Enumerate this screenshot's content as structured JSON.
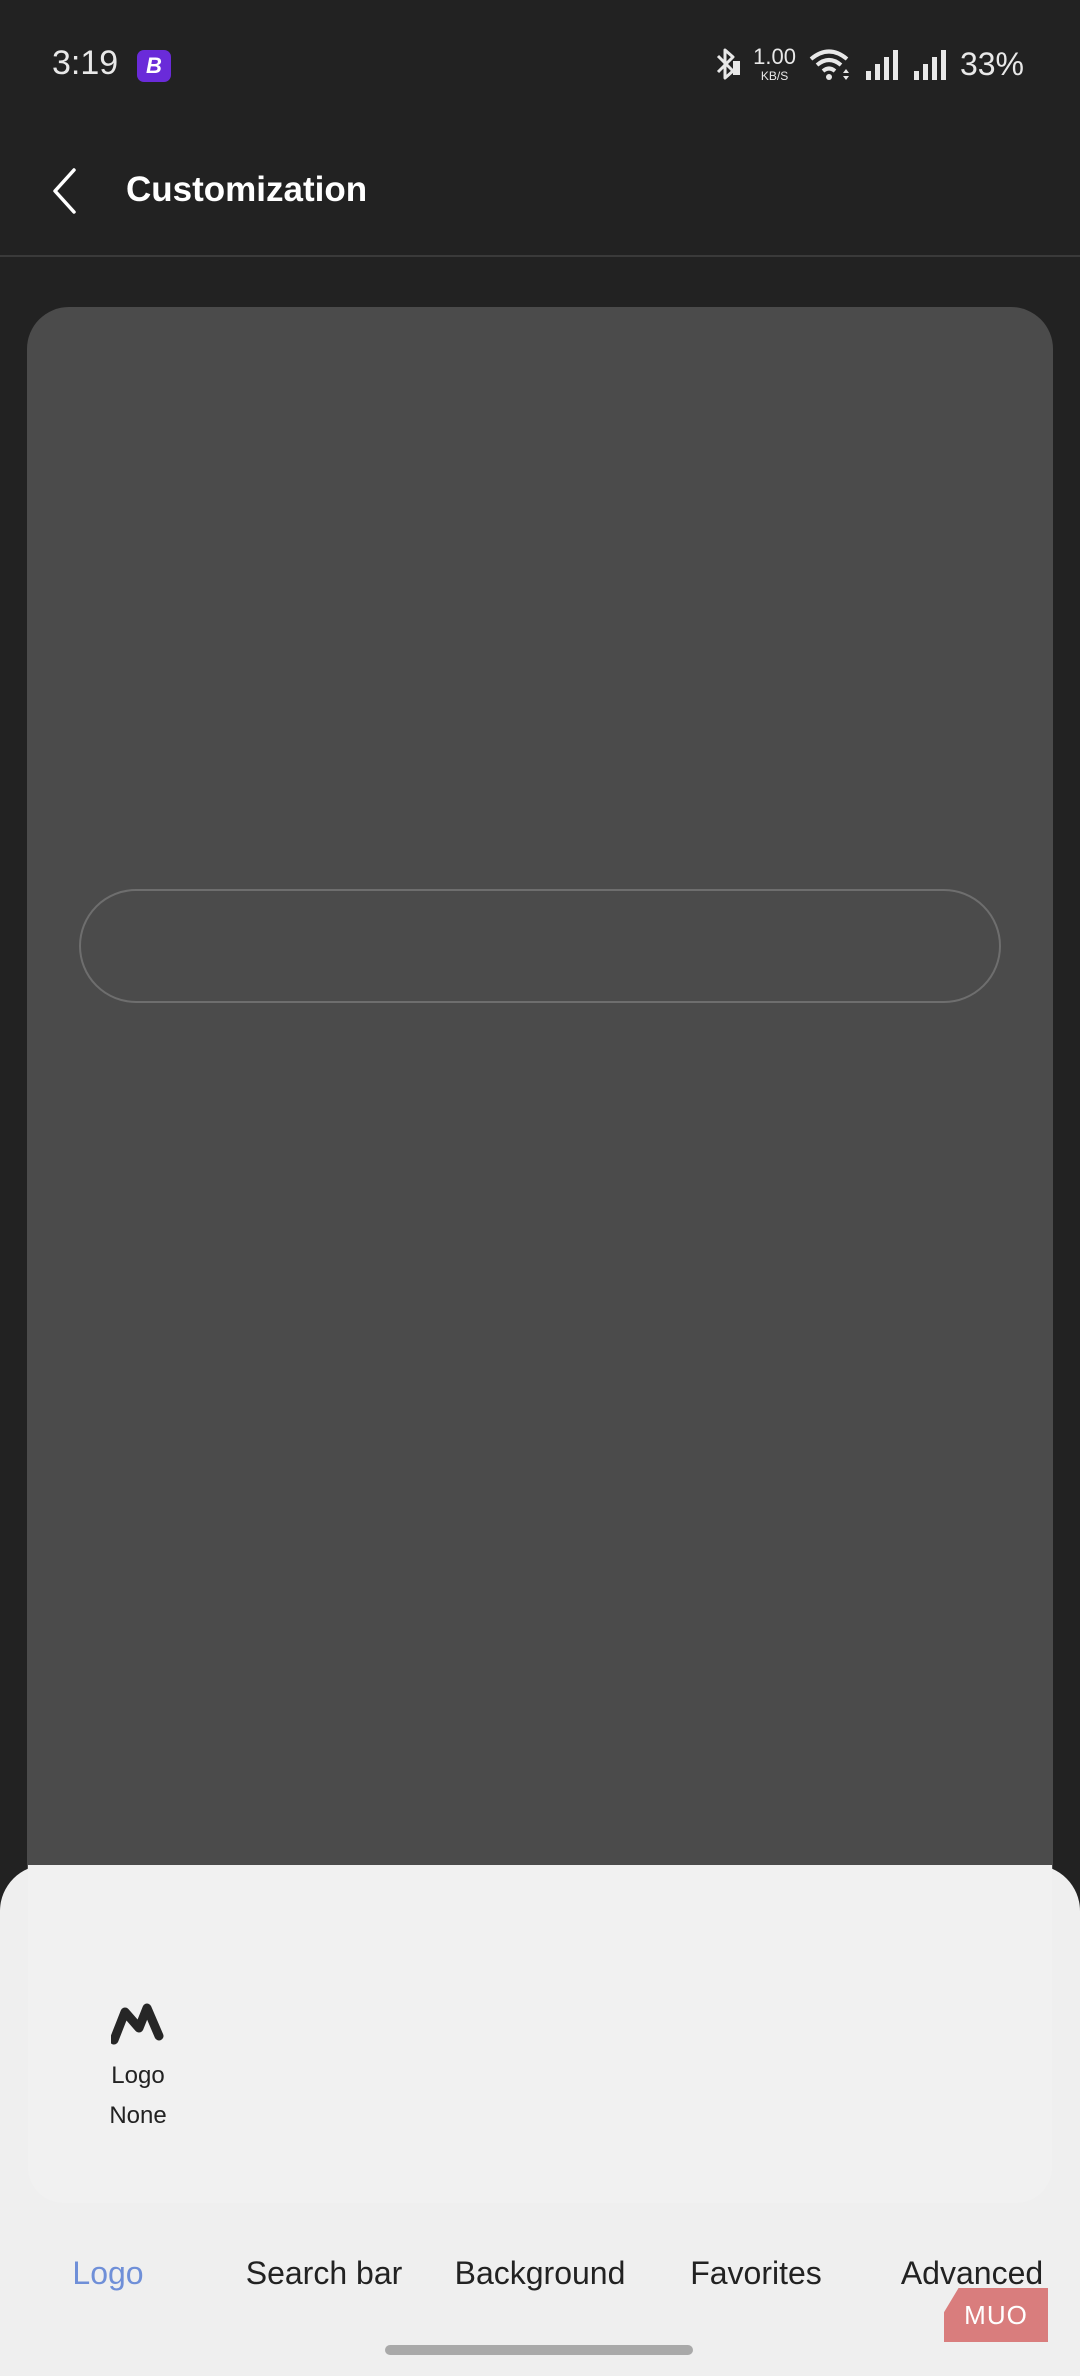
{
  "status_bar": {
    "time": "3:19",
    "app_badge_letter": "B",
    "speed_value": "1.00",
    "speed_unit": "KB/S",
    "battery": "33%"
  },
  "app_bar": {
    "title": "Customization"
  },
  "options": {
    "logo": {
      "label": "Logo",
      "value": "None"
    }
  },
  "tabs": [
    {
      "label": "Logo",
      "active": true
    },
    {
      "label": "Search bar",
      "active": false
    },
    {
      "label": "Background",
      "active": false
    },
    {
      "label": "Favorites",
      "active": false
    },
    {
      "label": "Advanced",
      "active": false
    }
  ],
  "watermark": "MUO",
  "colors": {
    "accent": "#6f8fd8",
    "background": "#222222",
    "preview_card": "#4b4b4b",
    "sheet": "#efefef",
    "app_badge": "#6a2bd9",
    "watermark": "#d97d7d"
  }
}
